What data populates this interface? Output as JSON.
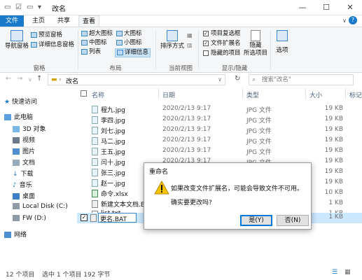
{
  "window": {
    "title": "改名",
    "minimize": "—",
    "maximize": "☐",
    "close": "✕"
  },
  "ribbon_tabs": {
    "file": "文件",
    "home": "主页",
    "share": "共享",
    "view": "查看"
  },
  "ribbon": {
    "pane": {
      "nav_pane": "导航窗格",
      "preview_pane": "预览窗格",
      "details_pane": "详细信息窗格",
      "label": "窗格"
    },
    "layout": {
      "xl_icons": "超大图标",
      "l_icons": "大图标",
      "m_icons": "中图标",
      "s_icons": "小图标",
      "list": "列表",
      "details": "详细信息",
      "label": "布局"
    },
    "current_view": {
      "sort_by": "排序方式",
      "label": "当前视图"
    },
    "show_hide": {
      "item_checkboxes": "项目复选框",
      "file_ext": "文件扩展名",
      "hidden_items": "隐藏的项目",
      "hide_selected": "隐藏",
      "hide_selected2": "所选项目",
      "label": "显示/隐藏"
    },
    "options": "选项"
  },
  "address": {
    "path": "改名",
    "search_placeholder": "搜索\"改名\""
  },
  "nav": {
    "quick_access": "快速访问",
    "this_pc": "此电脑",
    "items": [
      "3D 对象",
      "视频",
      "图片",
      "文档",
      "下载",
      "音乐",
      "桌面",
      "Local Disk (C:)",
      "FW (D:)"
    ],
    "network": "网络"
  },
  "columns": {
    "name": "名称",
    "date": "日期",
    "type": "类型",
    "size": "大小",
    "tags": "标记"
  },
  "files": [
    {
      "name": "程九.jpg",
      "date": "2020/2/13 9:17",
      "type": "JPG 文件",
      "size": "19 KB"
    },
    {
      "name": "李四.jpg",
      "date": "2020/2/13 9:17",
      "type": "JPG 文件",
      "size": "19 KB"
    },
    {
      "name": "刘七.jpg",
      "date": "2020/2/13 9:17",
      "type": "JPG 文件",
      "size": "19 KB"
    },
    {
      "name": "马二.jpg",
      "date": "2020/2/13 9:17",
      "type": "JPG 文件",
      "size": "19 KB"
    },
    {
      "name": "王五.jpg",
      "date": "2020/2/13 9:17",
      "type": "JPG 文件",
      "size": "19 KB"
    },
    {
      "name": "闫十.jpg",
      "date": "2020/2/13 9:17",
      "type": "JPG 文件",
      "size": "19 KB"
    },
    {
      "name": "张三.jpg",
      "date": "",
      "type": "",
      "size": "19 KB"
    },
    {
      "name": "赵一.jpg",
      "date": "",
      "type": "",
      "size": "19 KB"
    },
    {
      "name": "命令.xlsx",
      "date": "",
      "type": "",
      "size": "10 KB"
    },
    {
      "name": "新建文本文档.BAT",
      "date": "",
      "type": "",
      "size": "1 KB"
    },
    {
      "name": "list.txt",
      "date": "",
      "type": "",
      "size": "1 KB"
    },
    {
      "name": "更名.BAT",
      "date": "",
      "type": "",
      "size": "1 KB"
    }
  ],
  "status": {
    "count": "12 个项目",
    "selected": "选中 1 个项目  192 字节"
  },
  "dialog": {
    "title": "重命名",
    "message": "如果改变文件扩展名，可能会导致文件不可用。",
    "question": "确实要更改吗?",
    "yes": "是(Y)",
    "no": "否(N)"
  },
  "colors": {
    "accent": "#1979ca",
    "ribbon_bg": "#f5f6f7",
    "header_text": "#4c607a"
  }
}
